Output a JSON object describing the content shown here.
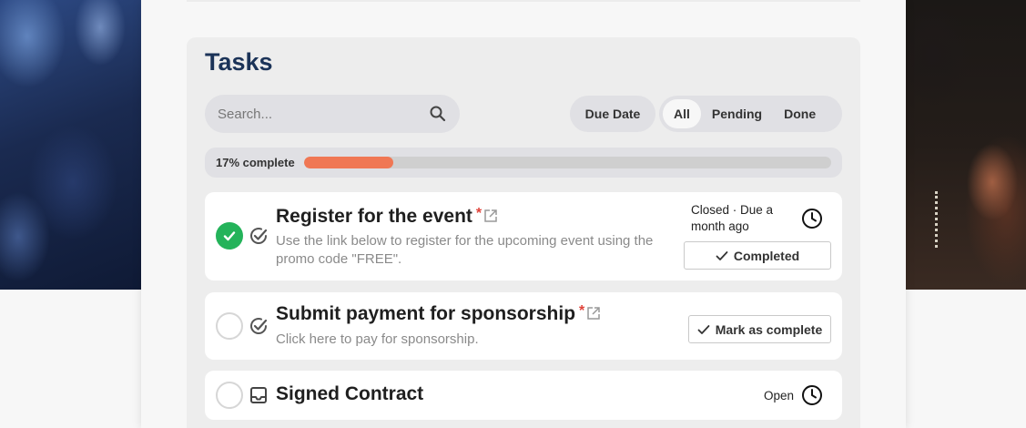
{
  "colors": {
    "title": "#1b3358",
    "progress_fill": "#f07754",
    "done_check": "#24b35a",
    "required_star": "#e0433a"
  },
  "header": {
    "title": "Tasks"
  },
  "search": {
    "placeholder": "Search...",
    "icon": "search-icon"
  },
  "filters": {
    "due_date_label": "Due Date",
    "options": [
      "All",
      "Pending",
      "Done"
    ],
    "selected": "All"
  },
  "progress": {
    "label": "17% complete",
    "fraction": 0.17
  },
  "tasks": [
    {
      "title": "Register for the event",
      "required_mark": "*",
      "description": "Use the link below to register for the upcoming event using the promo code \"FREE\".",
      "status": "Closed · Due a month ago",
      "action_label": "Completed",
      "done": true,
      "icons": [
        "check-circle-icon",
        "task-check-icon",
        "external-link-icon",
        "clock-icon"
      ]
    },
    {
      "title": "Submit payment for sponsorship",
      "required_mark": "*",
      "description": "Click here to pay for sponsorship.",
      "action_label": "Mark as complete",
      "done": false,
      "icons": [
        "task-check-icon",
        "external-link-icon"
      ]
    },
    {
      "title": "Signed Contract",
      "status": "Open",
      "done": false,
      "icons": [
        "inbox-icon",
        "clock-icon"
      ]
    }
  ]
}
